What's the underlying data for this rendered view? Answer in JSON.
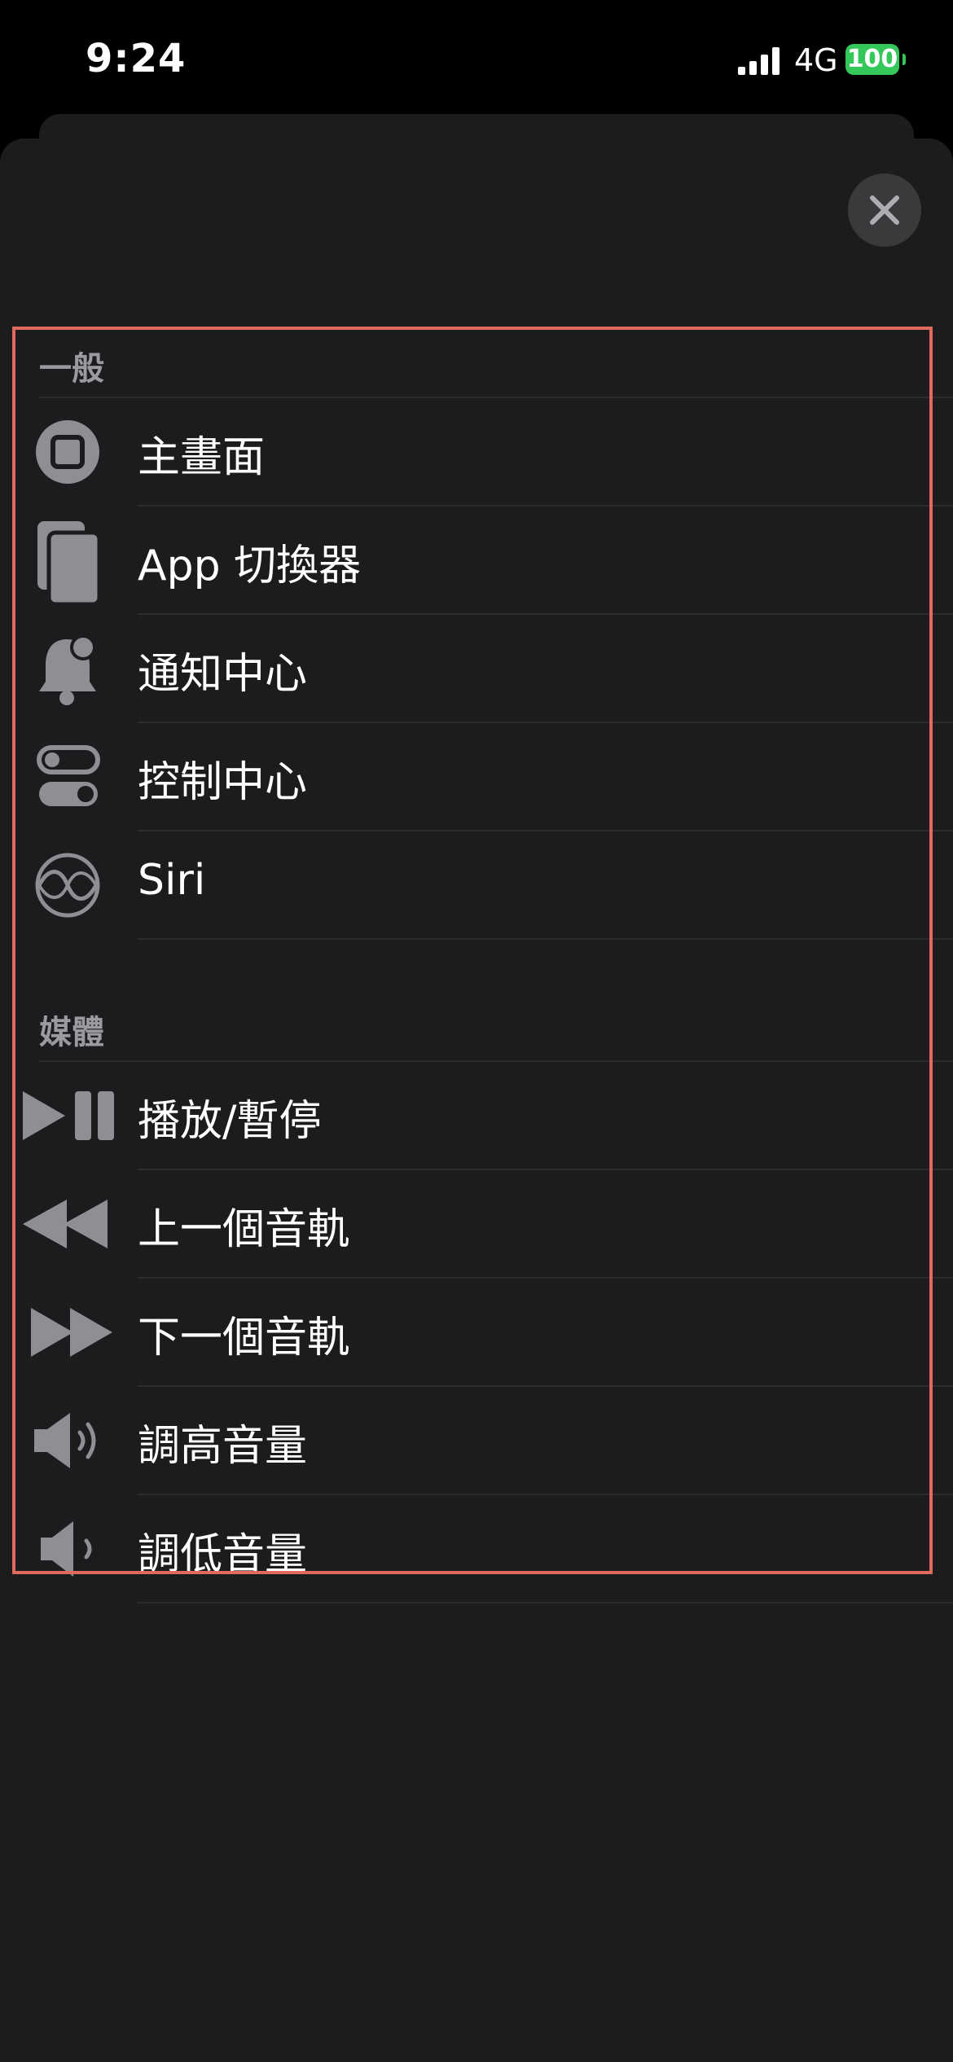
{
  "status": {
    "time": "9:24",
    "network": "4G",
    "battery": "100"
  },
  "sections": {
    "general": {
      "header": "一般",
      "items": [
        {
          "label": "主畫面",
          "icon": "home-button-icon"
        },
        {
          "label": "App 切換器",
          "icon": "app-switcher-icon"
        },
        {
          "label": "通知中心",
          "icon": "notification-bell-icon"
        },
        {
          "label": "控制中心",
          "icon": "control-center-toggles-icon"
        },
        {
          "label": "Siri",
          "icon": "siri-icon"
        }
      ]
    },
    "media": {
      "header": "媒體",
      "items": [
        {
          "label": "播放/暫停",
          "icon": "play-pause-icon"
        },
        {
          "label": "上一個音軌",
          "icon": "previous-track-icon"
        },
        {
          "label": "下一個音軌",
          "icon": "next-track-icon"
        },
        {
          "label": "調高音量",
          "icon": "volume-up-icon"
        },
        {
          "label": "調低音量",
          "icon": "volume-down-icon"
        }
      ]
    }
  },
  "colors": {
    "background": "#1c1c1e",
    "highlight_border": "#e06b5c",
    "icon_gray": "#8e8e93",
    "battery_green": "#34c759"
  }
}
